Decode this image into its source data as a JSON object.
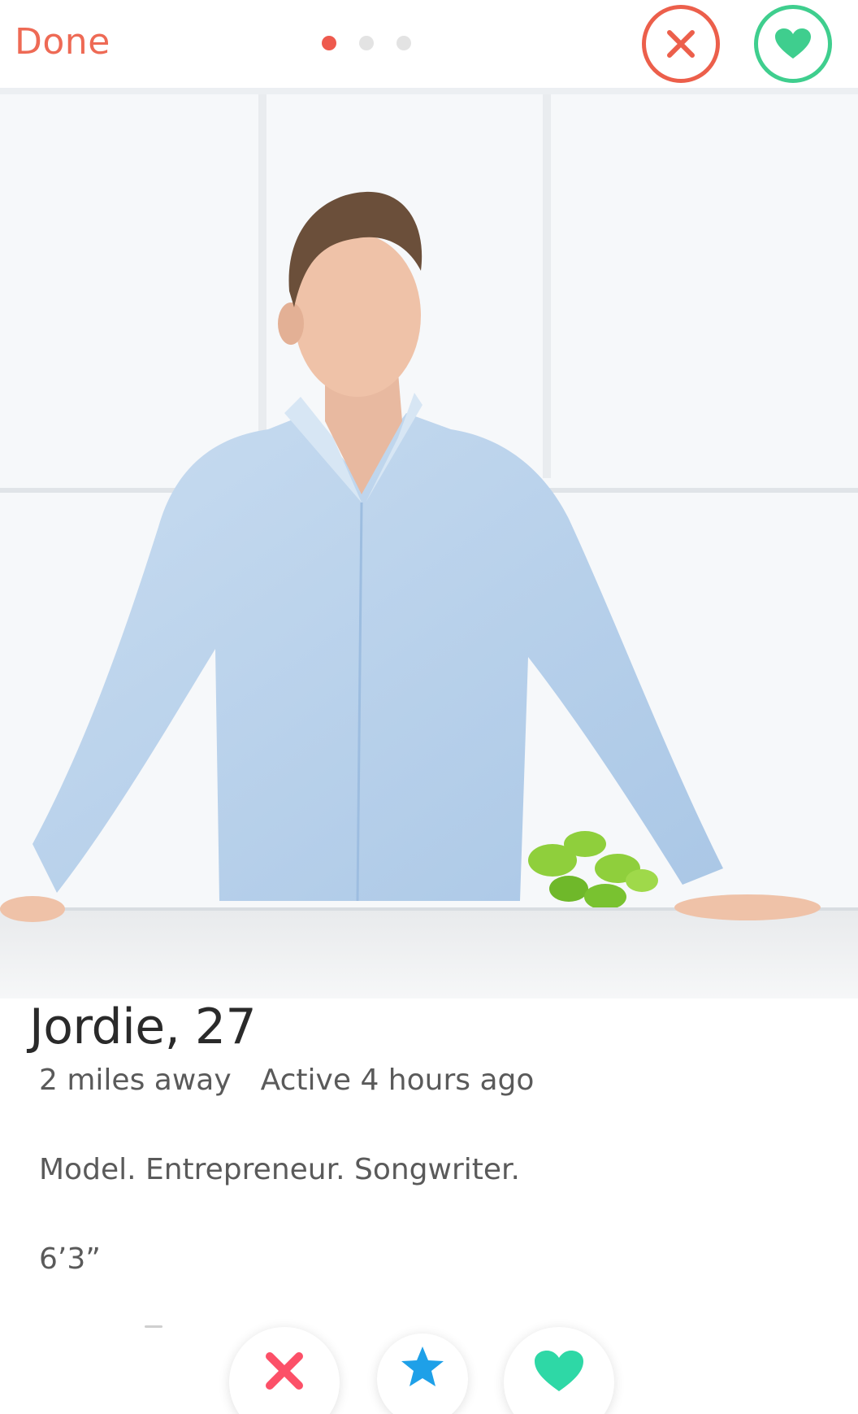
{
  "header": {
    "done_label": "Done",
    "photo_pager": {
      "count": 3,
      "active_index": 0
    }
  },
  "profile": {
    "name_age": "Jordie, 27",
    "distance": "2 miles away",
    "last_active": "Active 4 hours ago",
    "bio": "Model. Entrepreneur. Songwriter.",
    "height": "6’3”"
  },
  "actions": {
    "top": [
      {
        "name": "nope",
        "icon": "close-icon",
        "color": "#ec5f4b"
      },
      {
        "name": "like",
        "icon": "heart-icon",
        "color": "#3fce8e"
      }
    ],
    "bottom": [
      {
        "name": "nope",
        "icon": "close-icon",
        "color": "#fc5068"
      },
      {
        "name": "super-like",
        "icon": "star-icon",
        "color": "#1ea0e8"
      },
      {
        "name": "like",
        "icon": "heart-icon",
        "color": "#2ed8a6"
      }
    ]
  },
  "colors": {
    "accent": "#ee6a55",
    "text_primary": "#2a2a2a",
    "text_secondary": "#5a5a5a",
    "shirt": "#bcd6ee"
  }
}
